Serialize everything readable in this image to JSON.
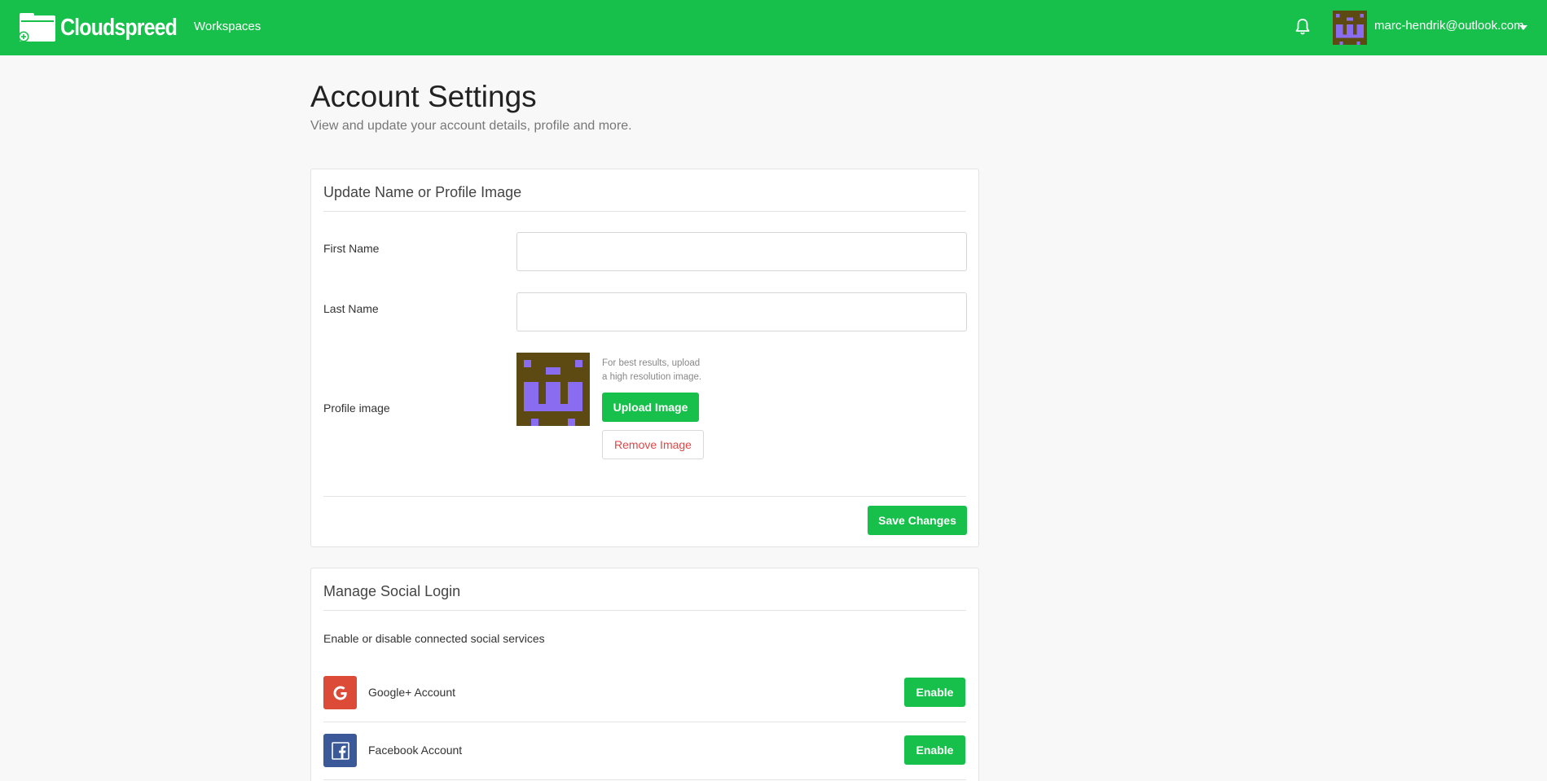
{
  "colors": {
    "brand_green": "#16c04a",
    "google_red": "#dc4a38",
    "facebook_blue": "#3b5998",
    "danger_red": "#e04646"
  },
  "nav": {
    "brand": "Cloudspreed",
    "workspaces": "Workspaces",
    "user_email": "marc-hendrik@outlook.com",
    "bell_icon": "bell-icon"
  },
  "page": {
    "title": "Account Settings",
    "subtitle": "View and update your account details, profile and more."
  },
  "profile_card": {
    "title": "Update Name or Profile Image",
    "first_name_label": "First Name",
    "first_name_value": "",
    "last_name_label": "Last Name",
    "last_name_value": "",
    "profile_image_label": "Profile image",
    "hint_line1": "For best results, upload",
    "hint_line2": "a high resolution image.",
    "upload_button": "Upload Image",
    "remove_button": "Remove Image",
    "save_button": "Save Changes"
  },
  "social_card": {
    "title": "Manage Social Login",
    "description": "Enable or disable connected social services",
    "services": [
      {
        "label": "Google+ Account",
        "icon": "google-icon",
        "button": "Enable"
      },
      {
        "label": "Facebook Account",
        "icon": "facebook-icon",
        "button": "Enable"
      }
    ]
  }
}
